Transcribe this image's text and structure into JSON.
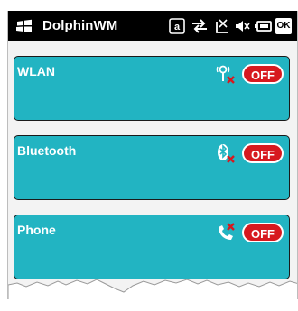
{
  "titlebar": {
    "app_title": "DolphinWM",
    "status_icons": [
      "keyboard-a-icon",
      "connectivity-arrows-icon",
      "signal-icon",
      "speaker-muted-icon",
      "battery-icon",
      "ok-button"
    ],
    "ok_label": "OK"
  },
  "panels": [
    {
      "label": "WLAN",
      "icon": "wlan-off-icon",
      "state": "OFF"
    },
    {
      "label": "Bluetooth",
      "icon": "bluetooth-off-icon",
      "state": "OFF"
    },
    {
      "label": "Phone",
      "icon": "phone-off-icon",
      "state": "OFF"
    }
  ],
  "colors": {
    "panel": "#22b4c2",
    "toggle_off": "#d7191f",
    "titlebar": "#000000"
  }
}
